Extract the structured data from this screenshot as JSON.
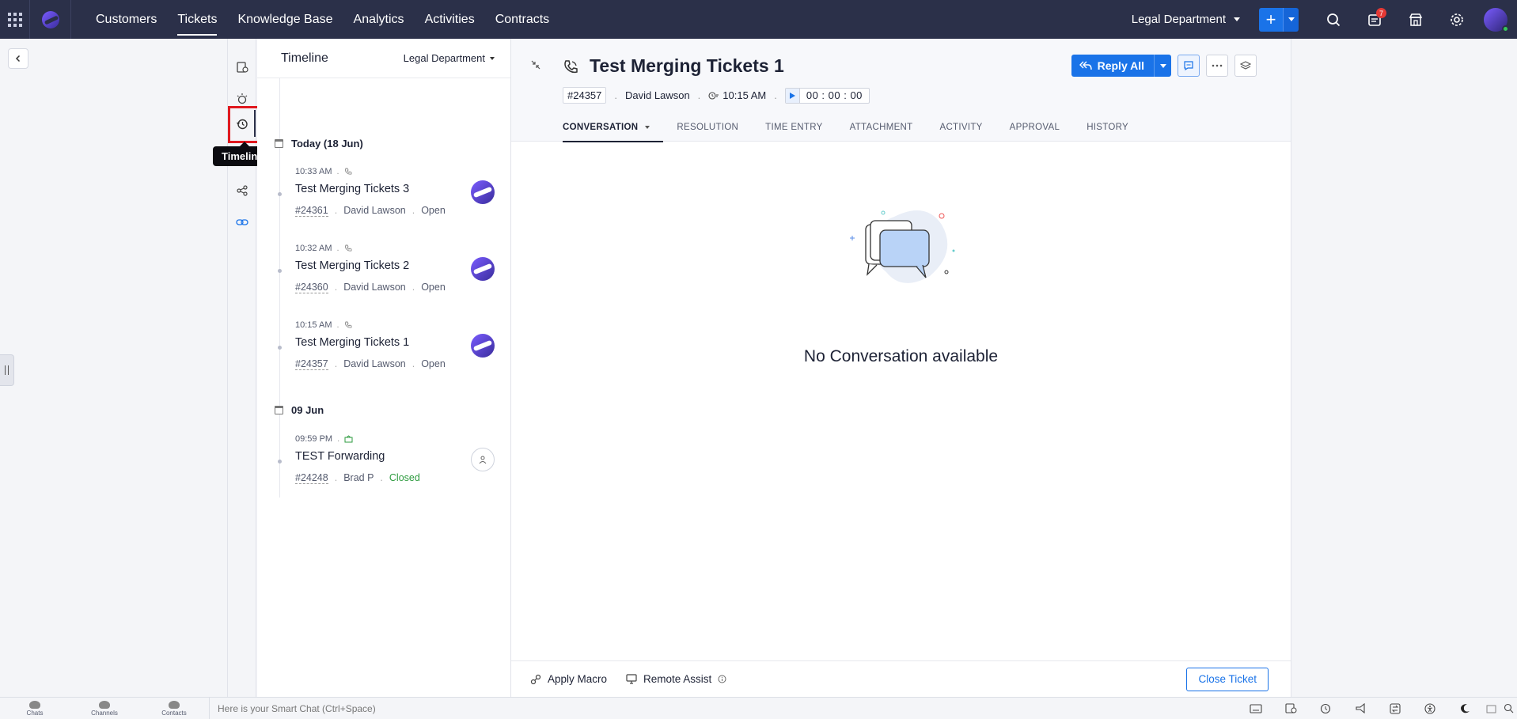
{
  "topnav": {
    "tabs": [
      {
        "label": "Customers"
      },
      {
        "label": "Tickets"
      },
      {
        "label": "Knowledge Base"
      },
      {
        "label": "Analytics"
      },
      {
        "label": "Activities"
      },
      {
        "label": "Contracts"
      }
    ],
    "active_tab": "Tickets",
    "department": "Legal Department",
    "notification_count": "7"
  },
  "icon_sidebar": {
    "tooltip": "Timeline"
  },
  "timeline": {
    "title": "Timeline",
    "department": "Legal Department",
    "groups": [
      {
        "date_label": "Today (18 Jun)",
        "items": [
          {
            "time": "10:33 AM",
            "subject": "Test Merging Tickets 3",
            "number": "#24361",
            "contact": "David Lawson",
            "status": "Open"
          },
          {
            "time": "10:32 AM",
            "subject": "Test Merging Tickets 2",
            "number": "#24360",
            "contact": "David Lawson",
            "status": "Open"
          },
          {
            "time": "10:15 AM",
            "subject": "Test Merging Tickets 1",
            "number": "#24357",
            "contact": "David Lawson",
            "status": "Open"
          }
        ]
      },
      {
        "date_label": "09 Jun",
        "items": [
          {
            "time": "09:59 PM",
            "subject": "TEST Forwarding",
            "number": "#24248",
            "contact": "Brad P",
            "status": "Closed"
          }
        ]
      }
    ]
  },
  "ticket": {
    "title": "Test Merging Tickets 1",
    "number": "#24357",
    "contact": "David Lawson",
    "time": "10:15 AM",
    "timer": "00 : 00 : 00",
    "reply_label": "Reply All",
    "tabs": [
      {
        "label": "CONVERSATION"
      },
      {
        "label": "RESOLUTION"
      },
      {
        "label": "TIME ENTRY"
      },
      {
        "label": "ATTACHMENT"
      },
      {
        "label": "ACTIVITY"
      },
      {
        "label": "APPROVAL"
      },
      {
        "label": "HISTORY"
      }
    ],
    "empty_message": "No Conversation available",
    "footer": {
      "apply_macro": "Apply Macro",
      "remote_assist": "Remote Assist",
      "close_ticket": "Close Ticket"
    }
  },
  "bottom_bar": {
    "chats": "Chats",
    "channels": "Channels",
    "contacts": "Contacts",
    "smart_chat_placeholder": "Here is your Smart Chat (Ctrl+Space)"
  },
  "colors": {
    "nav_bg": "#2b3049",
    "primary": "#1a73e8",
    "closed_status": "#2e9b3f",
    "highlight": "#e0191f"
  }
}
